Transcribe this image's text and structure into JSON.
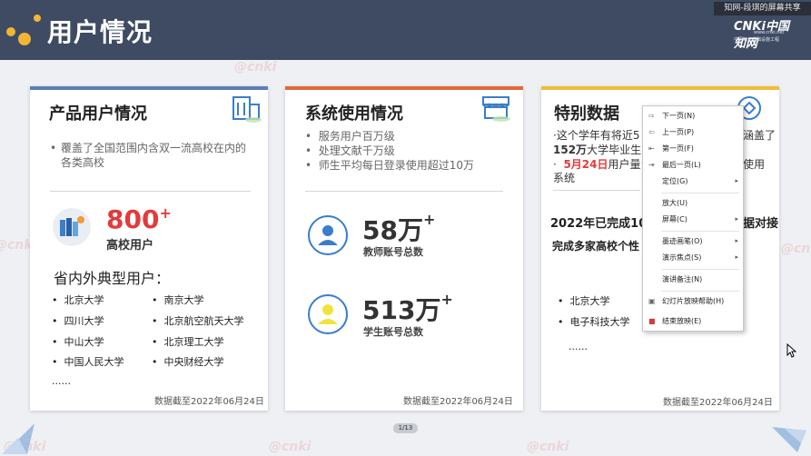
{
  "header": {
    "title": "用户情况",
    "share_tag": "知网-段琪的屏幕共享",
    "logo_main": "CNKi中国知网",
    "logo_url": "www.cnki.net",
    "logo_sub": "中国知识基础设施工程"
  },
  "watermark_text": "@cnki",
  "cards": [
    {
      "title": "产品用户情况",
      "icon": "building-icon",
      "bar_color": "#5b7fb3",
      "bullet": "覆盖了全国范围内含双一流高校在内的各类高校",
      "stat_value": "800",
      "stat_plus": "+",
      "stat_label": "高校用户",
      "subhead": "省内外典型用户：",
      "universities": [
        "北京大学",
        "南京大学",
        "四川大学",
        "北京航空航天大学",
        "中山大学",
        "北京理工大学",
        "中国人民大学",
        "中央财经大学"
      ],
      "ellipsis": "......",
      "footnote": "数据截至2022年06月24日"
    },
    {
      "title": "系统使用情况",
      "icon": "store-icon",
      "bar_color": "#e2683c",
      "bullets": [
        "服务用户百万级",
        "处理文献千万级",
        "师生平均每日登录使用超过10万"
      ],
      "stats": [
        {
          "value": "58万",
          "plus": "+",
          "label": "教师账号总数"
        },
        {
          "value": "513万",
          "plus": "+",
          "label": "学生账号总数"
        }
      ],
      "footnote": "数据截至2022年06月24日"
    },
    {
      "title": "特别数据",
      "icon": "target-icon",
      "bar_color": "#f0bd3c",
      "line1a": "·这个学年有将近5",
      "line1b": "涵盖了",
      "line2a": "152万",
      "line2b": "大学毕业生",
      "line3_date": "5月24日",
      "line3_rest": "用户量",
      "line3_tail": "使用",
      "line4": "系统",
      "line5a": "2022年已完成10",
      "line5b": "据对接",
      "line6": "完成多家高校个性",
      "universities": [
        "北京大学",
        "电子科技大学"
      ],
      "ellipsis": "......",
      "footnote": "数据截至2022年06月24日"
    }
  ],
  "context_menu": {
    "items": [
      {
        "label": "下一页(N)",
        "icon": "next-icon",
        "submenu": false
      },
      {
        "label": "上一页(P)",
        "icon": "prev-icon",
        "submenu": false
      },
      {
        "label": "第一页(F)",
        "icon": "first-icon",
        "submenu": false
      },
      {
        "label": "最后一页(L)",
        "icon": "last-icon",
        "submenu": false
      },
      {
        "label": "定位(G)",
        "icon": "",
        "submenu": true
      },
      {
        "label": "放大(U)",
        "icon": "",
        "submenu": false
      },
      {
        "label": "屏幕(C)",
        "icon": "",
        "submenu": true
      },
      {
        "label": "墨迹画笔(O)",
        "icon": "",
        "submenu": true
      },
      {
        "label": "演示焦点(S)",
        "icon": "",
        "submenu": true
      },
      {
        "label": "演讲备注(N)",
        "icon": "",
        "submenu": false
      },
      {
        "label": "幻灯片放映帮助(H)",
        "icon": "help-icon",
        "submenu": false
      },
      {
        "label": "结束放映(E)",
        "icon": "end-show-icon",
        "submenu": false
      }
    ]
  },
  "pager": "1/13"
}
